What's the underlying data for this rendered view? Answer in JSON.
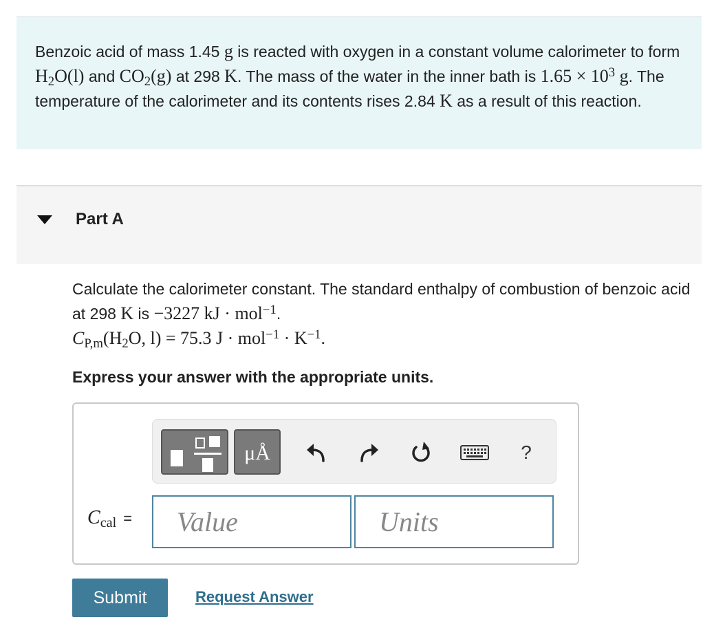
{
  "problem": {
    "t1": "Benzoic acid of mass 1.45 ",
    "m1": "g",
    "t2": "  is reacted with oxygen in a constant volume calorimeter to form ",
    "h2o_a": "H",
    "h2o_sub": "2",
    "h2o_b": "O(l)",
    "t3": " and ",
    "co2_a": "CO",
    "co2_sub": "2",
    "co2_b": "(g)",
    "t4": " at 298 ",
    "k1": "K",
    "t5": ". The mass of the water in the inner bath is ",
    "mass_a": "1.65 × 10",
    "mass_sup": "3",
    "mass_b": " g",
    "t6": ". The temperature of the calorimeter and its contents rises 2.84 ",
    "k2": "K",
    "t7": " as a result of this reaction."
  },
  "part": {
    "title": "Part A",
    "q1": "Calculate the calorimeter constant. The standard enthalpy of combustion of benzoic acid at 298 ",
    "q_k": "K",
    "q2": " is ",
    "q_val": "−3227 kJ · mol",
    "q_sup": "−1",
    "q3": ".",
    "cp_c": "C",
    "cp_sub": "P,m",
    "cp_expr_a": "(H",
    "cp_expr_sub": "2",
    "cp_expr_b": "O, l) = 75.3 J · mol",
    "cp_sup1": "−1",
    "cp_expr_c": " · K",
    "cp_sup2": "−1",
    "cp_end": ".",
    "instruction": "Express your answer with the appropriate units."
  },
  "toolbar": {
    "units_button": "μÅ",
    "help": "?",
    "icons": [
      "templates-icon",
      "units-icon",
      "undo-icon",
      "redo-icon",
      "reset-icon",
      "keyboard-icon",
      "help-icon"
    ]
  },
  "answer": {
    "var_c": "C",
    "var_sub": "cal",
    "eq": "=",
    "value_placeholder": "Value",
    "units_placeholder": "Units"
  },
  "actions": {
    "submit": "Submit",
    "request": "Request Answer"
  },
  "colors": {
    "problem_bg": "#e9f6f8",
    "input_border": "#4f85a0",
    "submit_bg": "#3f7c99",
    "link": "#2f6e8e"
  }
}
